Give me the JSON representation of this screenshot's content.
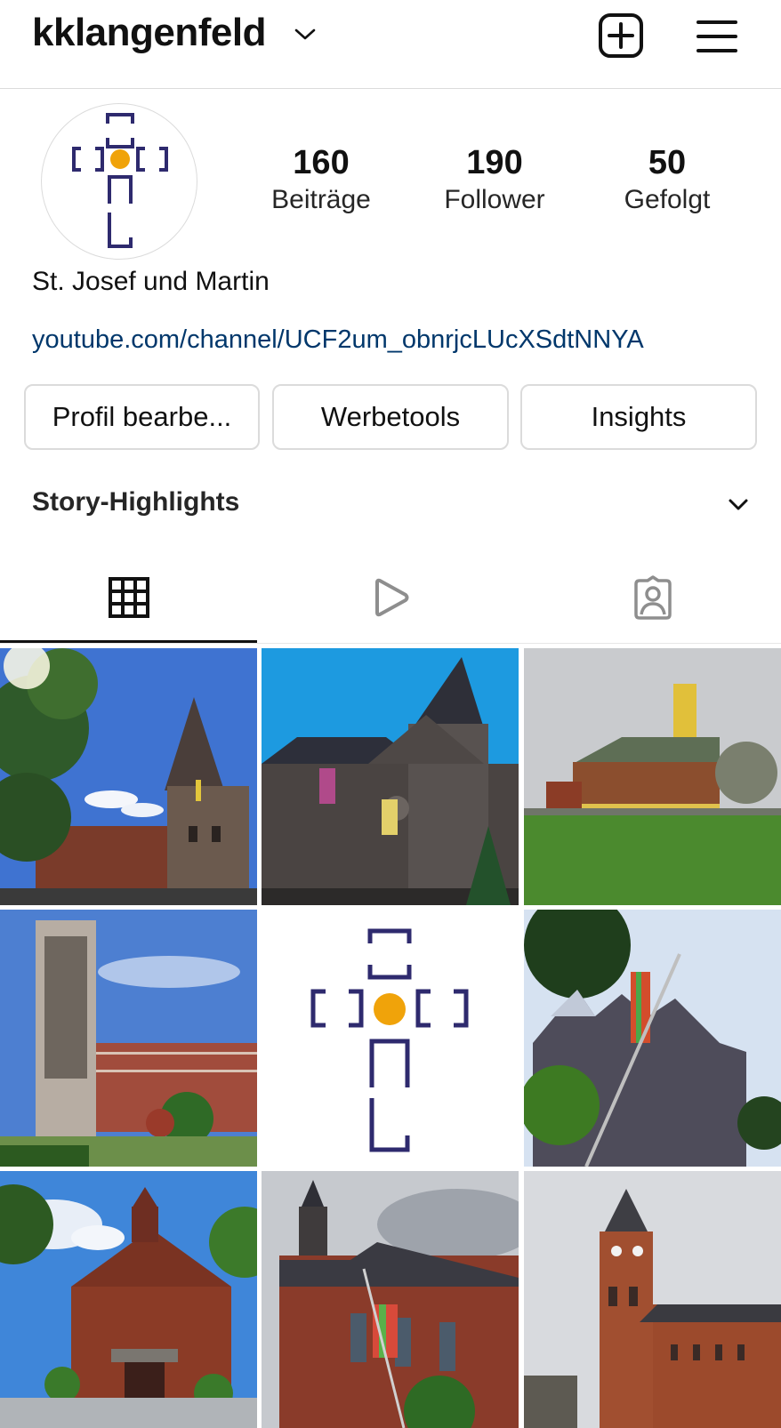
{
  "header": {
    "username": "kklangenfeld",
    "icons": {
      "account_switch": "chevron-down-icon",
      "create": "plus-square-icon",
      "menu": "hamburger-menu-icon"
    }
  },
  "profile": {
    "avatar_icon": "parish-cross-logo",
    "stats": [
      {
        "value": "160",
        "label": "Beiträge"
      },
      {
        "value": "190",
        "label": "Follower"
      },
      {
        "value": "50",
        "label": "Gefolgt"
      }
    ],
    "display_name": "St. Josef und Martin",
    "link": "youtube.com/channel/UCF2um_obnrjcLUcXSdtNNYA"
  },
  "actions": {
    "edit_profile": "Profil bearbe...",
    "promo_tools": "Werbetools",
    "insights": "Insights"
  },
  "highlights": {
    "label": "Story-Highlights"
  },
  "tabs": [
    {
      "name": "posts",
      "icon": "grid-icon",
      "active": true
    },
    {
      "name": "reels",
      "icon": "play-icon",
      "active": false
    },
    {
      "name": "tagged",
      "icon": "tagged-person-icon",
      "active": false
    }
  ],
  "colors": {
    "link": "#00376b",
    "logo_blue": "#2e2a6e",
    "logo_orange": "#f0a30a",
    "border": "#dbdbdb"
  },
  "posts": [
    {
      "subject": "church tower under blue sky with trees"
    },
    {
      "subject": "stone church at dusk with rainbow flags"
    },
    {
      "subject": "church with yellow tower and lawn"
    },
    {
      "subject": "modern concrete bell tower and brick church"
    },
    {
      "subject": "parish cross logo"
    },
    {
      "subject": "church roof with rainbow flag"
    },
    {
      "subject": "brick church with small belfry"
    },
    {
      "subject": "brick church with rainbow flag"
    },
    {
      "subject": "brick church with clock tower"
    }
  ]
}
